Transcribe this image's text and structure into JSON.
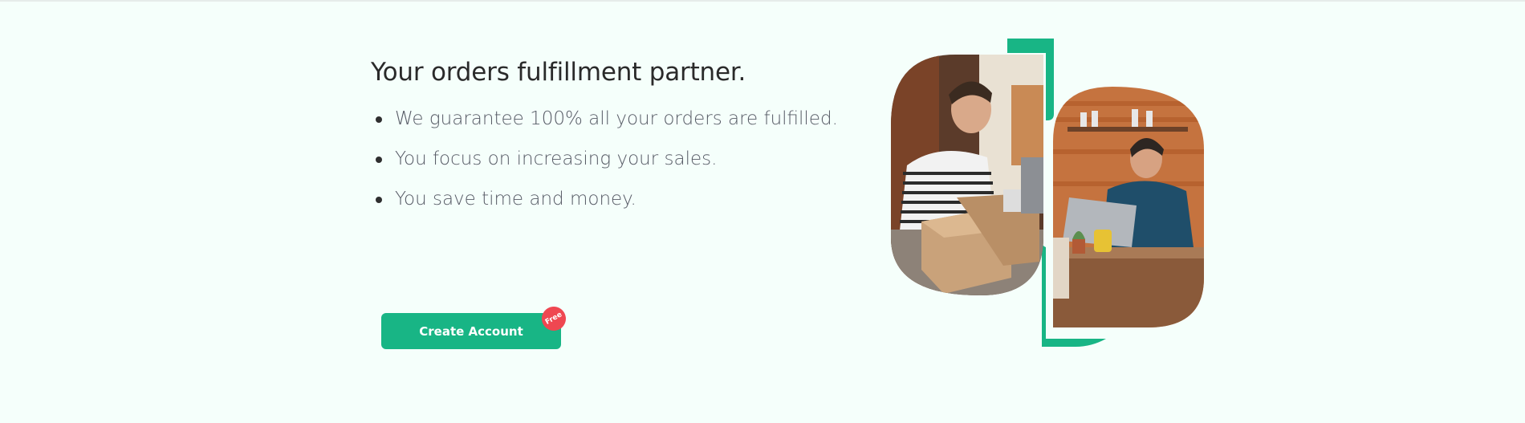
{
  "hero": {
    "title": "Your orders fulfillment partner.",
    "bullets": [
      "We guarantee 100% all your orders are fulfilled.",
      "You focus on increasing your sales.",
      "You save time and money."
    ]
  },
  "cta": {
    "label": "Create Account",
    "badge": "Free"
  },
  "colors": {
    "accent": "#18b585",
    "badge": "#ef4751",
    "background": "#f5fffb"
  }
}
